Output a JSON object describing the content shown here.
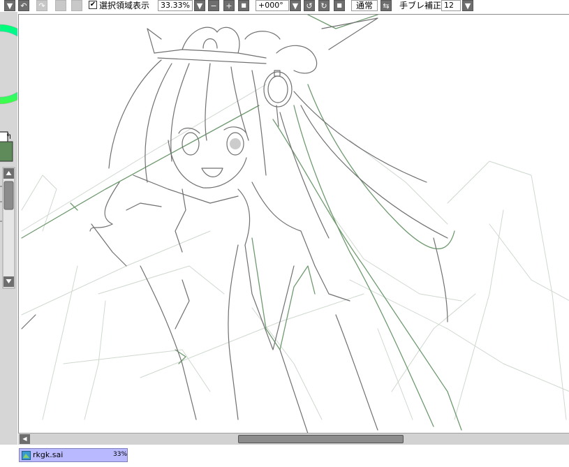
{
  "toolbar": {
    "selection_display_label": "選択領域表示",
    "selection_display_checked": "✔",
    "zoom_value": "33.33%",
    "rotation_value": "+000°",
    "blend_mode_label": "通常",
    "stabilizer_label": "手ブレ補正",
    "stabilizer_value": "12"
  },
  "icons": {
    "menu_down": "▼",
    "undo": "↶",
    "redo": "↷",
    "zoom_out": "−",
    "zoom_in": "+",
    "zoom_reset": "■",
    "rotate_ccw": "↺",
    "rotate_cw": "↻",
    "rotate_reset": "■",
    "flip": "⇆",
    "scroll_left": "◀",
    "scroll_up": "▲",
    "scroll_down": "▼",
    "swap_colors": "↰"
  },
  "colors": {
    "foreground_color": "#5f8a5a",
    "line_gray": "#707070",
    "line_green": "#6f9a6f",
    "line_light": "#cfd8cf",
    "tab_bg": "#b9b9ff"
  },
  "document_tab": {
    "filename": "rkgk.sai",
    "zoom": "33%"
  }
}
